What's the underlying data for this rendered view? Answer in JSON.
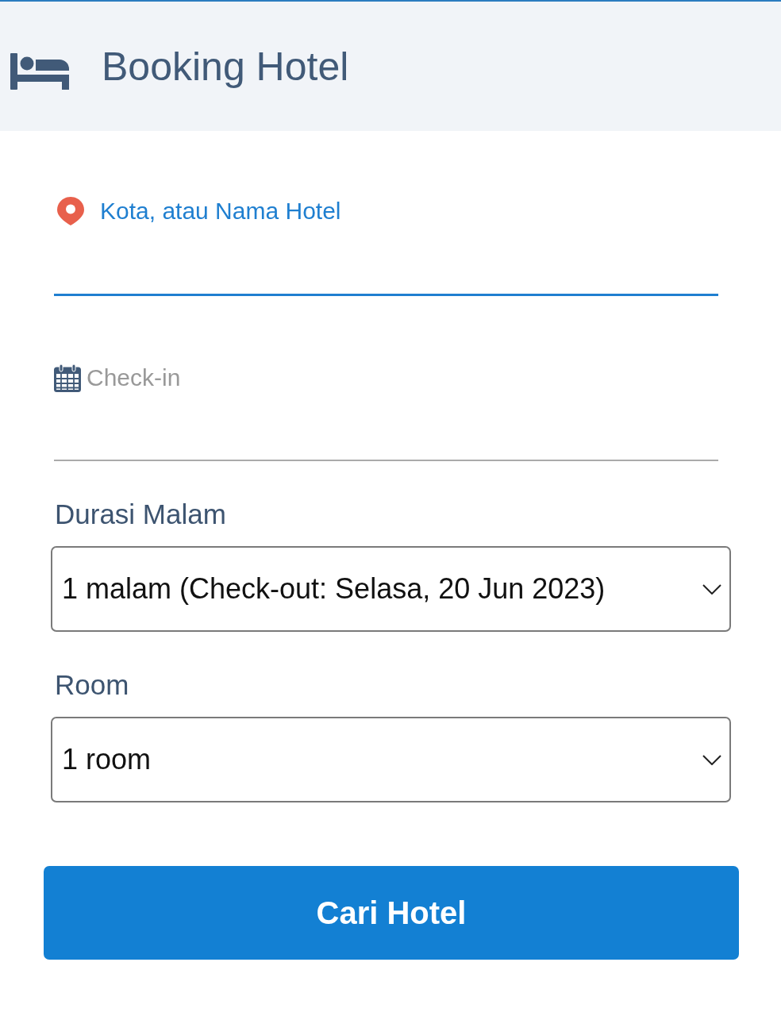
{
  "header": {
    "title": "Booking Hotel"
  },
  "destination_field": {
    "placeholder": "Kota, atau Nama Hotel",
    "focused": true
  },
  "checkin_field": {
    "placeholder": "Check-in",
    "focused": false
  },
  "duration_select": {
    "label": "Durasi Malam",
    "value": "1 malam (Check-out: Selasa, 20 Jun 2023)"
  },
  "room_select": {
    "label": "Room",
    "value": "1 room"
  },
  "search_button": {
    "label": "Cari Hotel"
  }
}
